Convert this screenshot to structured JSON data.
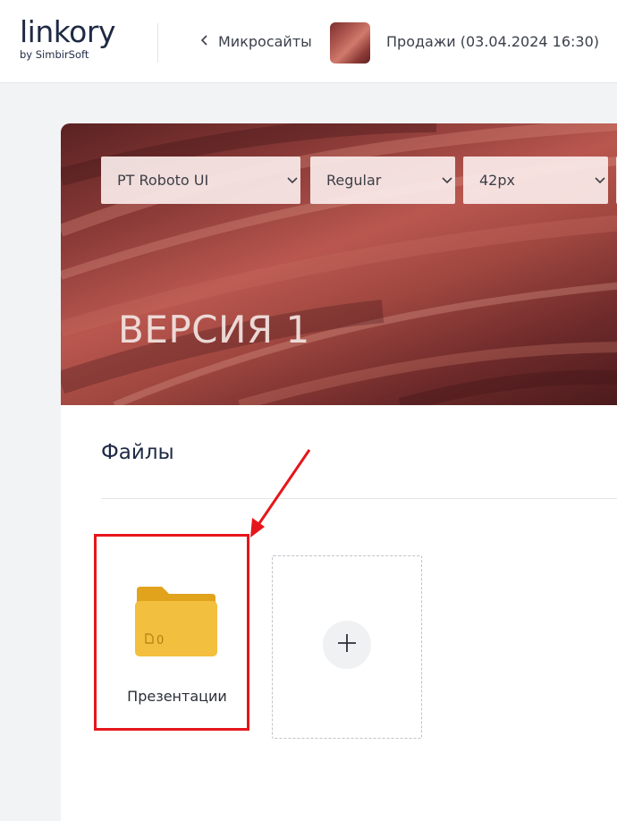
{
  "header": {
    "logo_main": "linkory",
    "logo_sub": "by SimbirSoft",
    "back_label": "Микросайты",
    "doc_title": "Продажи (03.04.2024 16:30)"
  },
  "banner": {
    "font_family_value": "PT Roboto UI",
    "font_weight_value": "Regular",
    "font_size_value": "42px",
    "title": "ВЕРСИЯ 1"
  },
  "files": {
    "section_title": "Файлы",
    "folder": {
      "name": "Презентации",
      "count": "0"
    }
  },
  "colors": {
    "folder": "#f0b83a",
    "annotation": "#e5161b"
  }
}
